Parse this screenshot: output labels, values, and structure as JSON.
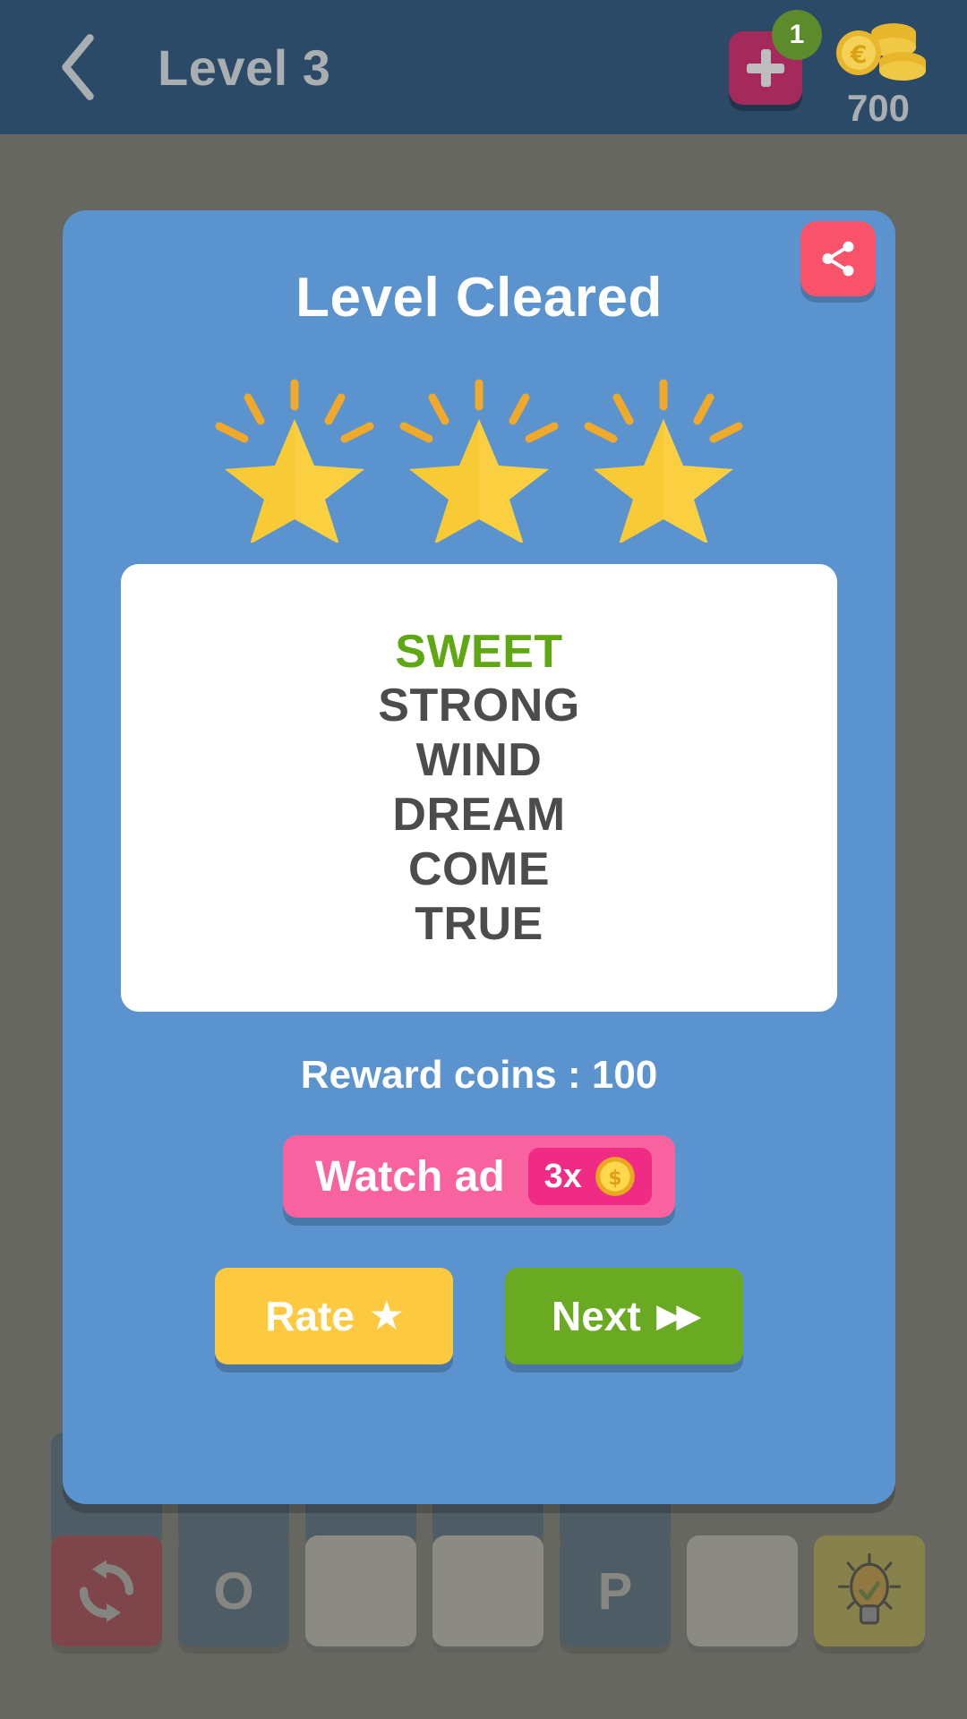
{
  "header": {
    "back_icon": "chevron-left-icon",
    "title": "Level 3",
    "add_button": {
      "icon": "plus-icon",
      "badge_count": "1"
    },
    "coins": {
      "icon": "coin-stack-icon",
      "amount": "700"
    }
  },
  "dialog": {
    "title": "Level Cleared",
    "share_icon": "share-icon",
    "stars_earned": 3,
    "stars_total": 3,
    "words": [
      {
        "text": "SWEET",
        "highlighted": true
      },
      {
        "text": "STRONG",
        "highlighted": false
      },
      {
        "text": "WIND",
        "highlighted": false
      },
      {
        "text": "DREAM",
        "highlighted": false
      },
      {
        "text": "COME",
        "highlighted": false
      },
      {
        "text": "TRUE",
        "highlighted": false
      }
    ],
    "reward_text": "Reward coins : 100",
    "watch_ad": {
      "label": "Watch ad",
      "multiplier": "3x",
      "coin_icon": "gold-coin-icon"
    },
    "rate_button": {
      "label": "Rate",
      "icon": "star-icon",
      "glyph": "★"
    },
    "next_button": {
      "label": "Next",
      "icon": "fast-forward-icon",
      "glyph": "▶▶"
    }
  },
  "board": {
    "bottom_row": [
      {
        "type": "action",
        "name": "shuffle-tile",
        "letter": "",
        "icon": "refresh-icon"
      },
      {
        "type": "letter",
        "name": "letter-tile-o",
        "letter": "O",
        "icon": ""
      },
      {
        "type": "empty",
        "name": "empty-tile",
        "letter": "",
        "icon": ""
      },
      {
        "type": "empty",
        "name": "empty-tile",
        "letter": "",
        "icon": ""
      },
      {
        "type": "letter",
        "name": "letter-tile-p",
        "letter": "P",
        "icon": ""
      },
      {
        "type": "empty",
        "name": "empty-tile",
        "letter": "",
        "icon": ""
      },
      {
        "type": "action",
        "name": "hint-tile",
        "letter": "",
        "icon": "lightbulb-icon"
      }
    ]
  },
  "colors": {
    "header_bg": "#2a4a68",
    "overlay": "#7d7d78",
    "dialog_bg": "#5a93cd",
    "share_red": "#f9536b",
    "highlight_green": "#5fa814",
    "word_gray": "#4c4c4c",
    "watch_pink": "#f8629f",
    "ad_badge_pink": "#ef2b85",
    "rate_yellow": "#fdc93f",
    "next_green": "#6aaa23",
    "star_gold": "#fcd043",
    "badge_green": "#5d8a2a",
    "plus_magenta": "#a42a5c"
  }
}
